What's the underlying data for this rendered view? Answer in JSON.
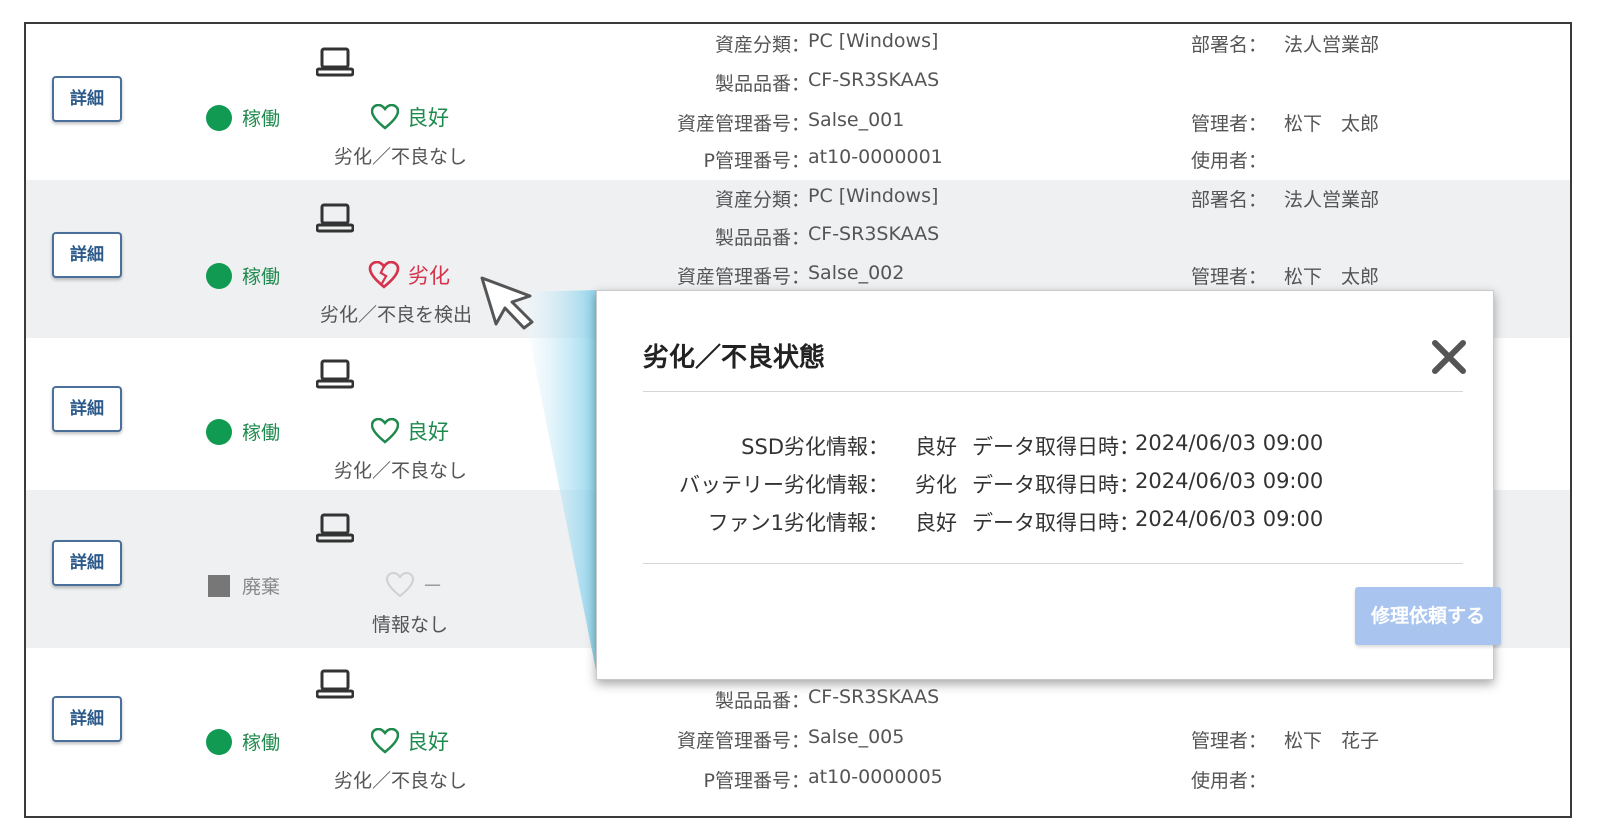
{
  "rows": [
    {
      "detail_label": "詳細",
      "status": {
        "type": "active",
        "label": "稼働"
      },
      "health": {
        "type": "good",
        "label": "良好",
        "sub": "劣化／不良なし"
      },
      "info": {
        "asset_class_label": "資産分類：",
        "asset_class": "PC [Windows]",
        "product_no_label": "製品品番：",
        "product_no": "CF-SR3SKAAS",
        "asset_mgmt_label": "資産管理番号：",
        "asset_mgmt": "Salse_001",
        "p_mgmt_label": "P管理番号：",
        "p_mgmt": "at10-0000001",
        "dept_label": "部署名：",
        "dept": "法人営業部",
        "manager_label": "管理者：",
        "manager": "松下　太郎",
        "user_label": "使用者：",
        "user": ""
      }
    },
    {
      "detail_label": "詳細",
      "status": {
        "type": "active",
        "label": "稼働"
      },
      "health": {
        "type": "bad",
        "label": "劣化",
        "sub": "劣化／不良を検出"
      },
      "info": {
        "asset_class_label": "資産分類：",
        "asset_class": "PC [Windows]",
        "product_no_label": "製品品番：",
        "product_no": "CF-SR3SKAAS",
        "asset_mgmt_label": "資産管理番号：",
        "asset_mgmt": "Salse_002",
        "dept_label": "部署名：",
        "dept": "法人営業部",
        "manager_label": "管理者：",
        "manager": "松下　太郎"
      }
    },
    {
      "detail_label": "詳細",
      "status": {
        "type": "active",
        "label": "稼働"
      },
      "health": {
        "type": "good",
        "label": "良好",
        "sub": "劣化／不良なし"
      }
    },
    {
      "detail_label": "詳細",
      "status": {
        "type": "disposed",
        "label": "廃棄"
      },
      "health": {
        "type": "none",
        "label": "－",
        "sub": "情報なし"
      }
    },
    {
      "detail_label": "詳細",
      "status": {
        "type": "active",
        "label": "稼働"
      },
      "health": {
        "type": "good",
        "label": "良好",
        "sub": "劣化／不良なし"
      },
      "info": {
        "product_no_label": "製品品番：",
        "product_no": "CF-SR3SKAAS",
        "asset_mgmt_label": "資産管理番号：",
        "asset_mgmt": "Salse_005",
        "p_mgmt_label": "P管理番号：",
        "p_mgmt": "at10-0000005",
        "manager_label": "管理者：",
        "manager": "松下　花子",
        "user_label": "使用者：",
        "user": ""
      }
    }
  ],
  "modal": {
    "title": "劣化／不良状態",
    "items": [
      {
        "label": "SSD劣化情報：",
        "value": "良好",
        "date_label": "データ取得日時：",
        "date": "2024/06/03 09:00"
      },
      {
        "label": "バッテリー劣化情報：",
        "value": "劣化",
        "date_label": "データ取得日時：",
        "date": "2024/06/03 09:00"
      },
      {
        "label": "ファン1劣化情報：",
        "value": "良好",
        "date_label": "データ取得日時：",
        "date": "2024/06/03 09:00"
      }
    ],
    "repair_button": "修理依頼する"
  },
  "colors": {
    "active_green": "#109a52",
    "bad_red": "#d6324c",
    "button_blue": "#a9c4ef",
    "detail_border": "#4a6f9a"
  }
}
